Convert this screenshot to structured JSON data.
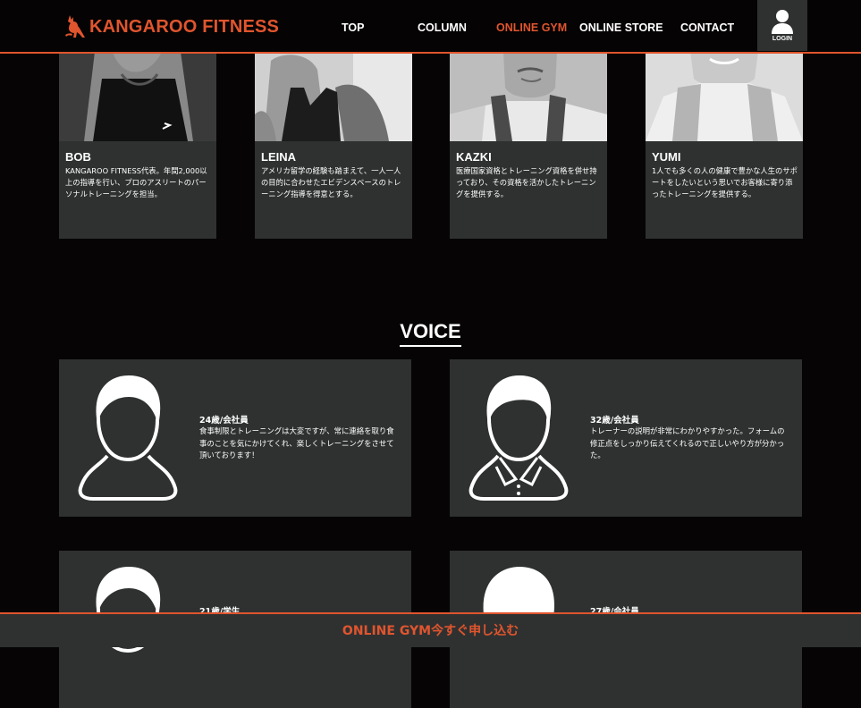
{
  "brand": {
    "name": "KANGAROO FITNESS",
    "color": "#e0552e"
  },
  "nav": {
    "items": [
      {
        "label": "TOP"
      },
      {
        "label": "COLUMN"
      },
      {
        "label": "ONLINE GYM",
        "active": true
      },
      {
        "label": "ONLINE STORE"
      },
      {
        "label": "CONTACT"
      }
    ],
    "login_label": "LOGIN"
  },
  "trainers": [
    {
      "name": "BOB",
      "desc": "KANGAROO FITNESS代表。年間2,000以上の指導を行い、プロのアスリートのパーソナルトレーニングを担当。"
    },
    {
      "name": "LEINA",
      "desc": "アメリカ留学の経験も踏まえて、一人一人の目的に合わせたエビデンスベースのトレーニング指導を得意とする。"
    },
    {
      "name": "KAZKI",
      "desc": "医療国家資格とトレーニング資格を併せ持っており、その資格を活かしたトレーニングを提供する。"
    },
    {
      "name": "YUMI",
      "desc": "1人でも多くの人の健康で豊かな人生のサポートをしたいという思いでお客様に寄り添ったトレーニングを提供する。"
    }
  ],
  "voice": {
    "title": "VOICE",
    "items": [
      {
        "meta": "24歳/会社員",
        "text": "食事制限とトレーニングは大変ですが、常に連絡を取り食事のことを気にかけてくれ、楽しくトレーニングをさせて頂いております！",
        "icon": "man-avatar-icon"
      },
      {
        "meta": "32歳/会社員",
        "text": "トレーナーの説明が非常にわかりやすかった。フォームの修正点をしっかり伝えてくれるので正しいやり方が分かった。",
        "icon": "man-collar-avatar-icon"
      },
      {
        "meta": "21歳/学生",
        "text": "",
        "icon": "man-avatar-icon"
      },
      {
        "meta": "27歳/会社員",
        "text": "",
        "icon": "woman-avatar-icon"
      }
    ]
  },
  "cta": {
    "label": "ONLINE GYM今すぐ申し込む"
  },
  "colors": {
    "background": "#060404",
    "card": "#2f3131",
    "accent": "#e0552e"
  }
}
